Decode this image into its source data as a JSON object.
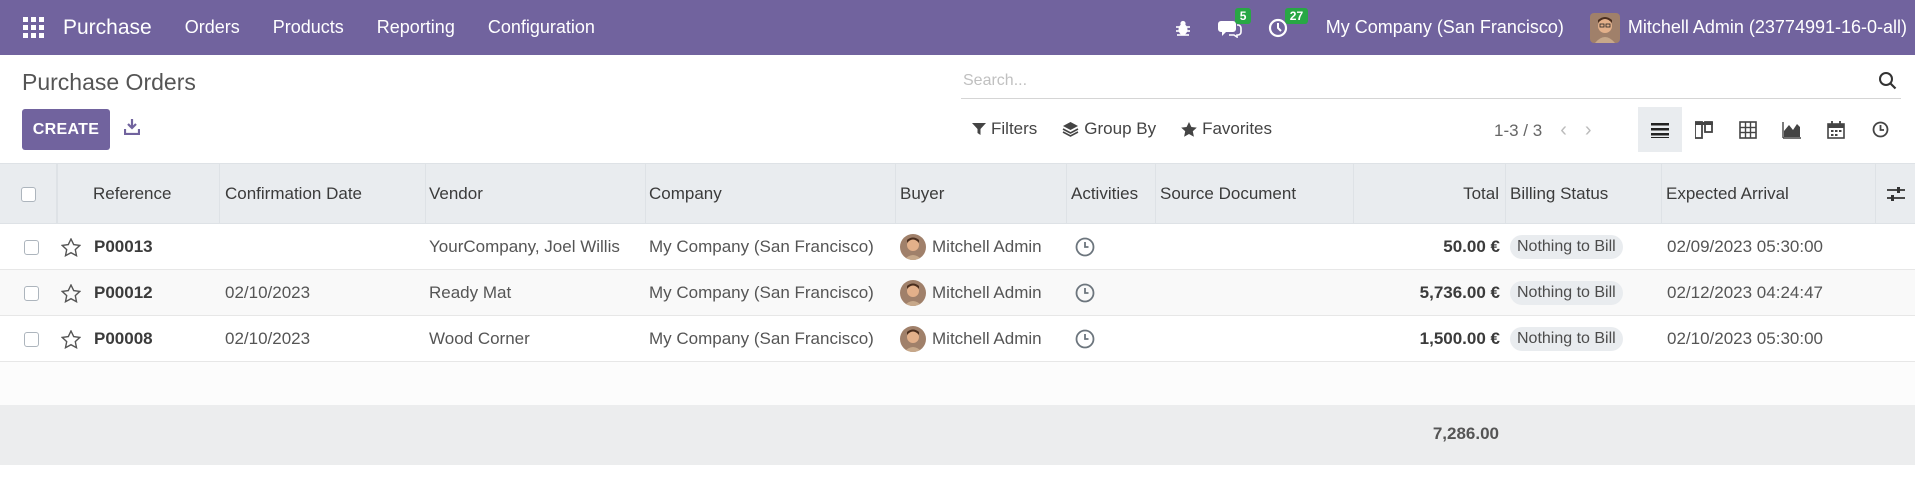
{
  "navbar": {
    "app_name": "Purchase",
    "menu": [
      "Orders",
      "Products",
      "Reporting",
      "Configuration"
    ],
    "messages_count": "5",
    "activities_count": "27",
    "company": "My Company (San Francisco)",
    "user": "Mitchell Admin (23774991-16-0-all)",
    "icons": [
      "apps-icon",
      "bug-icon",
      "chat-icon",
      "clock-icon"
    ],
    "badge_color": "#28a745",
    "brand_color": "#71639e"
  },
  "control_panel": {
    "title": "Purchase Orders",
    "search_placeholder": "Search...",
    "create_label": "CREATE",
    "filters_label": "Filters",
    "group_by_label": "Group By",
    "favorites_label": "Favorites",
    "pager_value": "1-3 / 3",
    "views": [
      "list-view",
      "kanban-view",
      "pivot-view",
      "graph-view",
      "calendar-view",
      "activity-view"
    ],
    "active_view": "list-view"
  },
  "table": {
    "columns": [
      "Reference",
      "Confirmation Date",
      "Vendor",
      "Company",
      "Buyer",
      "Activities",
      "Source Document",
      "Total",
      "Billing Status",
      "Expected Arrival"
    ],
    "rows": [
      {
        "reference": "P00013",
        "confirmation_date": "",
        "vendor": "YourCompany, Joel Willis",
        "company": "My Company (San Francisco)",
        "buyer": "Mitchell Admin",
        "source_document": "",
        "total": "50.00 €",
        "billing_status": "Nothing to Bill",
        "expected_arrival": "02/09/2023 05:30:00"
      },
      {
        "reference": "P00012",
        "confirmation_date": "02/10/2023",
        "vendor": "Ready Mat",
        "company": "My Company (San Francisco)",
        "buyer": "Mitchell Admin",
        "source_document": "",
        "total": "5,736.00 €",
        "billing_status": "Nothing to Bill",
        "expected_arrival": "02/12/2023 04:24:47"
      },
      {
        "reference": "P00008",
        "confirmation_date": "02/10/2023",
        "vendor": "Wood Corner",
        "company": "My Company (San Francisco)",
        "buyer": "Mitchell Admin",
        "source_document": "",
        "total": "1,500.00 €",
        "billing_status": "Nothing to Bill",
        "expected_arrival": "02/10/2023 05:30:00"
      }
    ],
    "footer_total": "7,286.00"
  }
}
